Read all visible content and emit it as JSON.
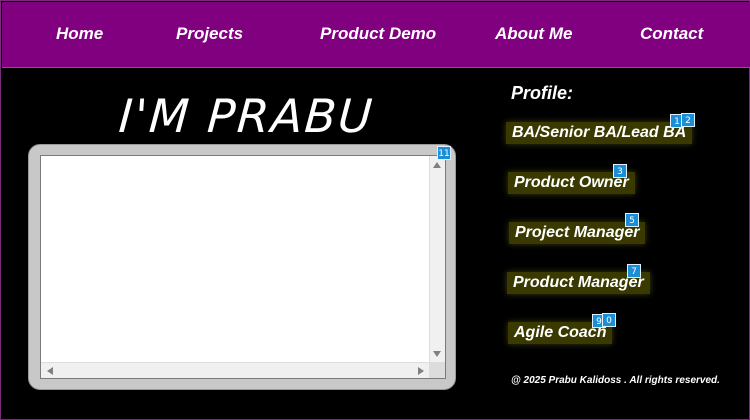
{
  "nav": {
    "items": [
      "Home",
      "Projects",
      "Product Demo",
      "About Me",
      "Contact"
    ]
  },
  "hero": {
    "title": "I'M PRABU"
  },
  "profile": {
    "title": "Profile:",
    "roles": [
      "BA/Senior BA/Lead BA",
      "Product Owner",
      "Project Manager",
      "Product Manager",
      "Agile Coach"
    ]
  },
  "badges": [
    "1",
    "2",
    "3",
    "5",
    "7",
    "9",
    "0",
    "11"
  ],
  "footer": {
    "text": "@ 2025 Prabu Kalidoss . All rights reserved."
  },
  "colors": {
    "nav_bg": "#800080",
    "page_bg": "#000000",
    "role_bg": "#3a3a00",
    "badge_bg": "#1a8fd8"
  }
}
